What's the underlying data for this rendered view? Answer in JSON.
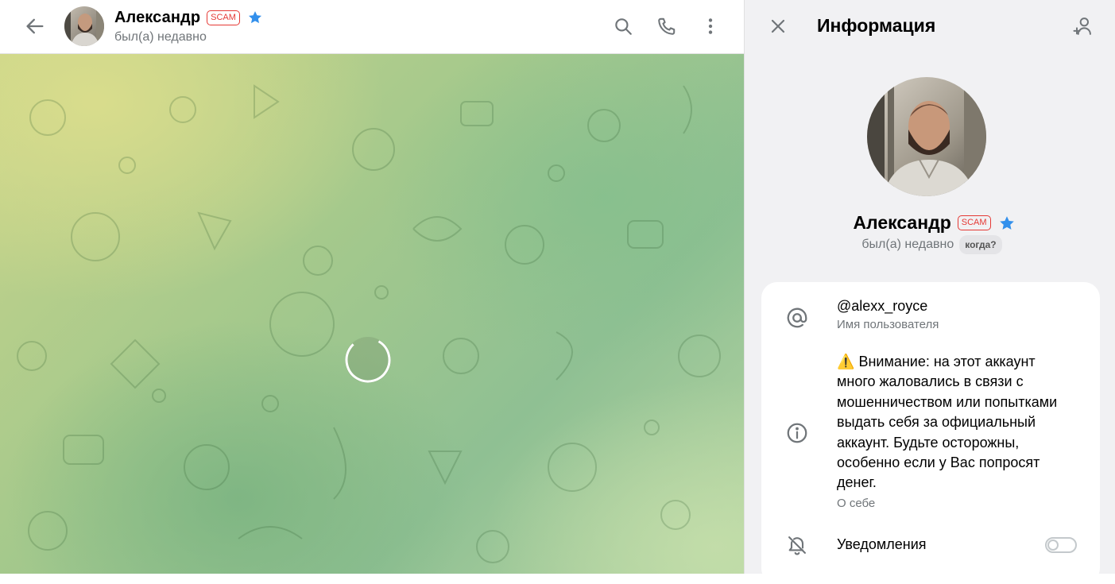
{
  "chat": {
    "contact_name": "Александр",
    "scam_label": "SCAM",
    "status": "был(а) недавно"
  },
  "info_panel": {
    "title": "Информация",
    "profile_name": "Александр",
    "scam_label": "SCAM",
    "status": "был(а) недавно",
    "when_chip": "когда?",
    "username": "@alexx_royce",
    "username_caption": "Имя пользователя",
    "bio_warning_glyph": "⚠️",
    "bio": "Внимание: на этот аккаунт много жаловались в связи с мошенничеством или попытками выдать себя за официальный аккаунт. Будьте осторожны, особенно если у Вас попросят денег.",
    "bio_caption": "О себе",
    "notifications_label": "Уведомления",
    "notifications_enabled": false
  },
  "colors": {
    "accent": "#3390ec",
    "scam_red": "#e53935",
    "secondary_text": "#707579",
    "panel_bg": "#f1f1f3"
  },
  "icons": {
    "back": "arrow-left-icon",
    "search": "search-icon",
    "call": "phone-icon",
    "more": "more-vertical-icon",
    "verified": "star-icon",
    "close": "close-icon",
    "add_contact": "add-user-icon",
    "username": "at-sign-icon",
    "bio": "info-icon",
    "notifications": "bell-off-icon"
  }
}
